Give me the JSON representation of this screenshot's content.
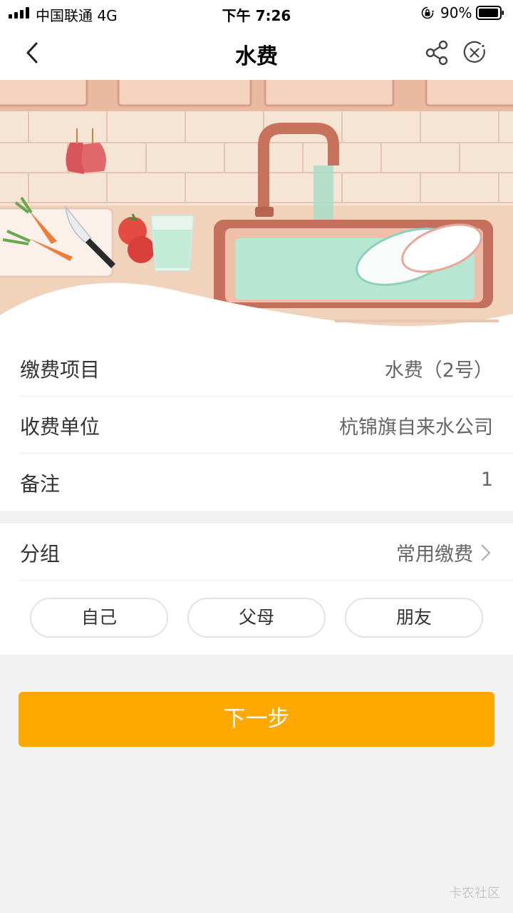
{
  "status_bar": {
    "carrier": "中国联通   4G",
    "time": "下午 7:26",
    "battery": "90%"
  },
  "nav": {
    "title": "水费",
    "icons": [
      "back-icon",
      "share-icon",
      "close-icon"
    ]
  },
  "info": {
    "rows": [
      {
        "label": "缴费项目",
        "value": "水费（2号）"
      },
      {
        "label": "收费单位",
        "value": "杭锦旗自来水公司"
      },
      {
        "label": "备注",
        "value": "1"
      }
    ]
  },
  "group": {
    "label": "分组",
    "value": "常用缴费",
    "chips": [
      "自己",
      "父母",
      "朋友"
    ]
  },
  "next_button": {
    "label": "下一步"
  },
  "watermark": "卡农社区",
  "colors": {
    "accent": "#ffa800",
    "background": "#f2f2f2"
  }
}
